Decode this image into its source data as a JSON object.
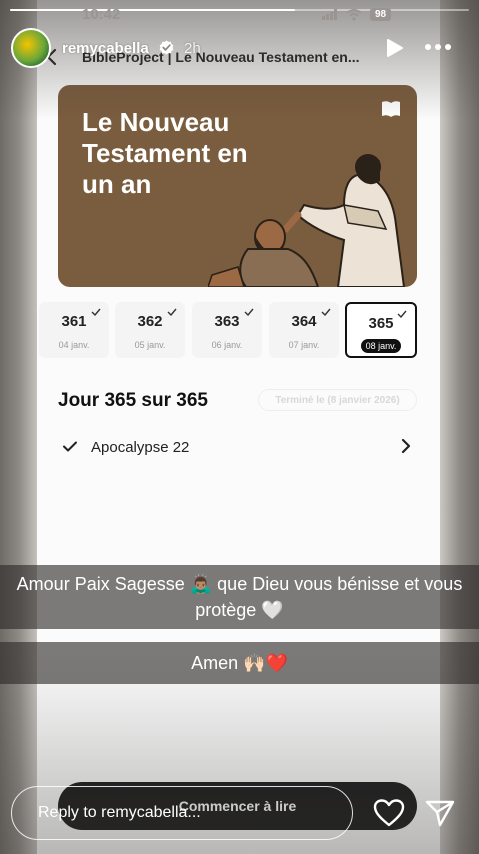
{
  "story": {
    "progress_fraction": 0.62,
    "username": "remycabella",
    "verified": true,
    "time_ago": "2h",
    "reply_placeholder": "Reply to remycabella...",
    "captions": [
      "Amour Paix Sagesse 🙇🏽‍♂️ que Dieu vous bénisse et vous protège 🤍",
      "Amen 🙌🏻❤️"
    ]
  },
  "phone_status": {
    "time": "10:42",
    "battery": "98"
  },
  "app": {
    "title": "BibleProject | Le Nouveau Testament en...",
    "banner_title": "Le Nouveau Testament en un an",
    "days": [
      {
        "number": "361",
        "date": "04 janv.",
        "done": true,
        "selected": false
      },
      {
        "number": "362",
        "date": "05 janv.",
        "done": true,
        "selected": false
      },
      {
        "number": "363",
        "date": "06 janv.",
        "done": true,
        "selected": false
      },
      {
        "number": "364",
        "date": "07 janv.",
        "done": true,
        "selected": false
      },
      {
        "number": "365",
        "date": "08 janv.",
        "done": true,
        "selected": true
      }
    ],
    "day_heading": "Jour 365 sur 365",
    "finished_label": "Terminé le (8 janvier 2026)",
    "reading_item": "Apocalypse 22",
    "start_button": "Commencer à lire"
  },
  "colors": {
    "banner_bg": "#7a5c3e",
    "accent_dark": "#111111"
  }
}
